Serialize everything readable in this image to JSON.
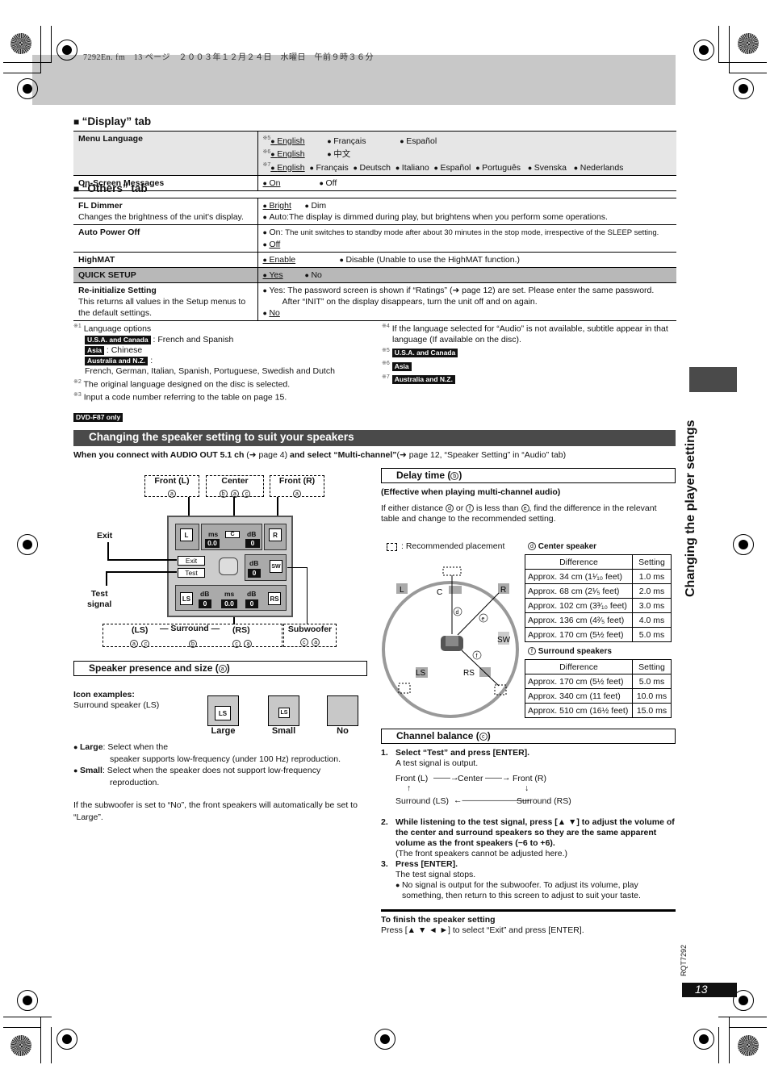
{
  "header": {
    "file_info": "7292En. fm　13 ページ　２００３年１２月２４日　水曜日　午前９時３６分"
  },
  "display_tab": {
    "title": "“Display” tab",
    "rows": [
      {
        "label": "Menu Language",
        "lines": [
          {
            "mark": "※5",
            "options": [
              "English",
              "Français",
              "Español"
            ],
            "default": 0
          },
          {
            "mark": "※6",
            "options": [
              "English",
              "中文"
            ],
            "default": 0
          },
          {
            "mark": "※7",
            "options": [
              "English",
              "Français",
              "Deutsch",
              "Italiano",
              "Español",
              "Português",
              "Svenska",
              "Nederlands"
            ],
            "default": 0
          }
        ]
      },
      {
        "label": "On-Screen Messages",
        "options": [
          "On",
          "Off"
        ],
        "default": 0
      }
    ]
  },
  "others_tab": {
    "title": "“Others” tab",
    "fl_dimmer": {
      "label": "FL Dimmer",
      "desc": "Changes the brightness of the unit's display.",
      "opt1": "Bright",
      "opt2": "Dim",
      "opt3": "Auto:The display is dimmed during play, but brightens when you perform some operations."
    },
    "auto_power_off": {
      "label": "Auto Power Off",
      "on_prefix": "On:",
      "on_text": "The unit switches to standby mode after about 30 minutes in the stop mode, irrespective of the SLEEP setting.",
      "off": "Off"
    },
    "highmat": {
      "label": "HighMAT",
      "opt1": "Enable",
      "opt2": "Disable (Unable to use the HighMAT function.)"
    },
    "quick_setup": {
      "label": "QUICK SETUP",
      "opt1": "Yes",
      "opt2": "No"
    },
    "reinit": {
      "label": "Re-initialize Setting",
      "desc": "This returns all values in the Setup menus to the default settings.",
      "yes_prefix": "Yes:",
      "yes_text": "The password screen is shown if “Ratings” (➜ page 12) are set. Please enter the same password. After “INIT” on the display disappears, turn the unit off and on again.",
      "no": "No"
    }
  },
  "footnotes": {
    "n1_mark": "※1",
    "n1_title": "Language options",
    "n1_usa_badge": "U.S.A. and Canada",
    "n1_usa_text": ": French and Spanish",
    "n1_asia_badge": "Asia",
    "n1_asia_text": ": Chinese",
    "n1_aus_badge": "Australia and N.Z.",
    "n1_aus_text": ":",
    "n1_aus_langs": "French, German, Italian, Spanish, Portuguese, Swedish and Dutch",
    "n2_mark": "※2",
    "n2": "The original language designed on the disc is selected.",
    "n3_mark": "※3",
    "n3": "Input a code number referring to the table on page 15.",
    "n4_mark": "※4",
    "n4": "If the language selected for “Audio” is not available, subtitle appear in that language (If available on the disc).",
    "n5_mark": "※5",
    "n5": "U.S.A. and Canada",
    "n6_mark": "※6",
    "n6": "Asia",
    "n7_mark": "※7",
    "n7": "Australia and N.Z."
  },
  "model_badge": "DVD-F87 only",
  "speaker_section": {
    "title": "Changing the speaker setting to suit your speakers",
    "intro_bold1": "When you connect with AUDIO OUT 5.1 ch",
    "intro_ref1": " (➜ page 4) ",
    "intro_bold2": "and select “Multi-channel”",
    "intro_ref2": "(➜ page 12, “Speaker Setting” in “Audio” tab)"
  },
  "diagram": {
    "front_l": "Front (L)",
    "center": "Center",
    "front_r": "Front (R)",
    "exit_label": "Exit",
    "test_label_1": "Test",
    "test_label_2": "signal",
    "ls": "(LS)",
    "surround": "— Surround —",
    "rs": "(RS)",
    "subwoofer": "Subwoofer",
    "spk_l": "L",
    "spk_c": "C",
    "spk_r": "R",
    "spk_sw": "SW",
    "spk_ls": "LS",
    "spk_rs": "RS",
    "ms": "ms",
    "db": "dB",
    "center_ms": "0.0",
    "center_db": "0",
    "sw_db": "0",
    "ls_db": "0",
    "surr_ms": "0.0",
    "rs_db": "0",
    "btn_exit": "Exit",
    "btn_test": "Test",
    "mark_a": "a",
    "mark_b": "b",
    "mark_c": "c"
  },
  "speaker_presence": {
    "title": "Speaker presence and size (",
    "mark": "a",
    "icon_examples": "Icon examples:",
    "surround_ls": "Surround speaker (LS)",
    "large": "Large",
    "small": "Small",
    "no": "No",
    "icon_ls": "LS",
    "large_desc_bold": "Large",
    "large_desc": ": Select when the",
    "large_desc2": "speaker supports low-frequency (under 100 Hz) reproduction.",
    "small_desc_bold": "Small",
    "small_desc": ": Select when the speaker does not support low-frequency",
    "small_desc2": "reproduction.",
    "note": "If the subwoofer is set to “No”, the front speakers will automatically be set to “Large”."
  },
  "delay_time": {
    "title": "Delay time (",
    "mark": "b",
    "effective": "(Effective when playing multi-channel audio)",
    "desc_1": "If either distance ",
    "mark_d": "d",
    "desc_2": " or ",
    "mark_f": "f",
    "desc_3": " is less than ",
    "mark_e": "e",
    "desc_4": ", find the difference in the relevant table and change to the recommended setting.",
    "legend": ": Recommended placement",
    "room": {
      "l": "L",
      "c": "C",
      "r": "R",
      "sw": "SW",
      "ls": "LS",
      "rs": "RS",
      "d": "d",
      "e": "e",
      "f": "f"
    },
    "center_table": {
      "title": "Center speaker",
      "mark": "d",
      "headers": [
        "Difference",
        "Setting"
      ],
      "rows": [
        [
          "Approx. 34 cm (1¹⁄₁₀ feet)",
          "1.0 ms"
        ],
        [
          "Approx. 68 cm (2¹⁄₅ feet)",
          "2.0 ms"
        ],
        [
          "Approx. 102 cm (3³⁄₁₀ feet)",
          "3.0 ms"
        ],
        [
          "Approx. 136 cm (4²⁄₅ feet)",
          "4.0 ms"
        ],
        [
          "Approx. 170 cm (5½ feet)",
          "5.0 ms"
        ]
      ]
    },
    "surround_table": {
      "title": "Surround speakers",
      "mark": "f",
      "headers": [
        "Difference",
        "Setting"
      ],
      "rows": [
        [
          "Approx. 170 cm (5½ feet)",
          "5.0 ms"
        ],
        [
          "Approx. 340 cm (11 feet)",
          "10.0 ms"
        ],
        [
          "Approx. 510 cm (16½ feet)",
          "15.0 ms"
        ]
      ]
    }
  },
  "channel_balance": {
    "title": "Channel balance (",
    "mark": "c",
    "step1_num": "1.",
    "step1": "Select “Test” and press [ENTER].",
    "step1_sub": "A test signal is output.",
    "flow_fl": "Front (L)",
    "flow_c": "Center",
    "flow_fr": "Front (R)",
    "flow_ls": "Surround (LS)",
    "flow_rs": "Surround (RS)",
    "step2_num": "2.",
    "step2": "While listening to the test signal, press [▲ ▼] to adjust the volume of the center and surround speakers so they are the same apparent volume as the front speakers (−6 to +6).",
    "step2_sub": "(The front speakers cannot be adjusted here.)",
    "step3_num": "3.",
    "step3": "Press [ENTER].",
    "step3_sub": "The test signal stops.",
    "step3_note": "No signal is output for the subwoofer. To adjust its volume, play something, then return to this screen to adjust to suit your taste.",
    "finish_title": "To finish the speaker setting",
    "finish_text": "Press [▲ ▼ ◄ ►] to select “Exit” and press [ENTER]."
  },
  "side_title": "Changing the player settings",
  "doc_code": "RQT7292",
  "page_number": "13"
}
